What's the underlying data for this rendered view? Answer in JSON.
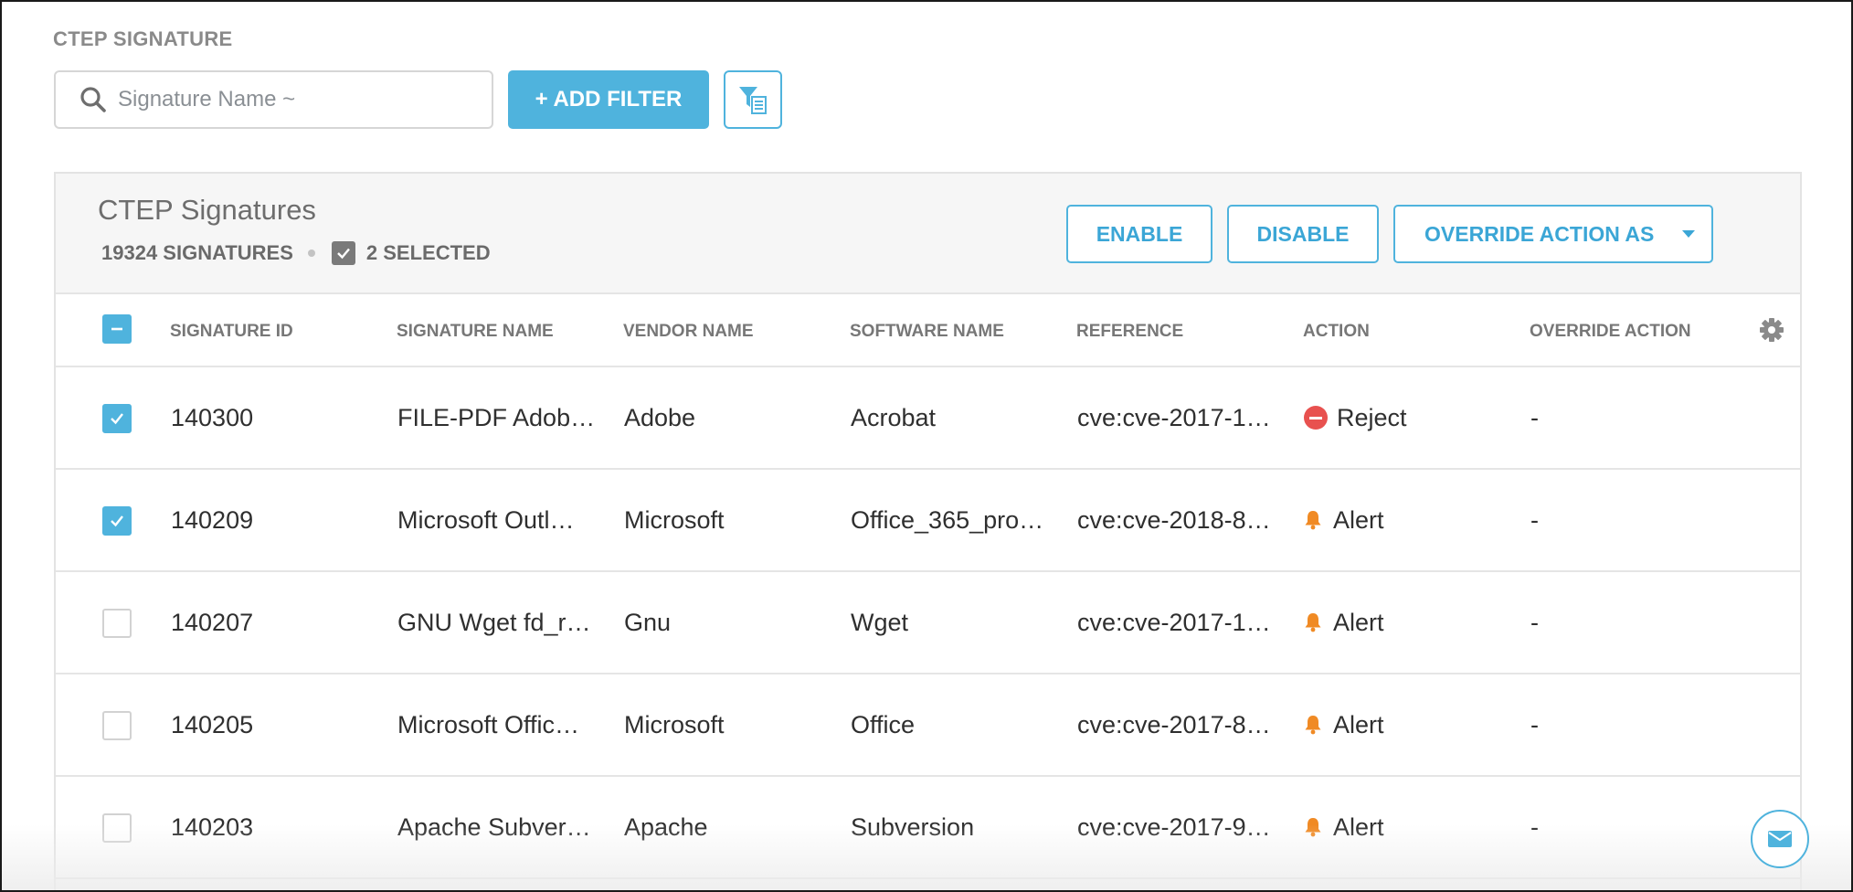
{
  "page": {
    "section_title": "CTEP SIGNATURE"
  },
  "search": {
    "placeholder": "Signature Name ~"
  },
  "toolbar": {
    "add_filter_label": "+ ADD FILTER"
  },
  "panel": {
    "title": "CTEP Signatures",
    "signature_count": "19324 SIGNATURES",
    "selected_label": "2 SELECTED",
    "buttons": {
      "enable": "ENABLE",
      "disable": "DISABLE",
      "override": "OVERRIDE ACTION AS"
    }
  },
  "table": {
    "columns": {
      "signature_id": "SIGNATURE ID",
      "signature_name": "SIGNATURE NAME",
      "vendor_name": "VENDOR NAME",
      "software_name": "SOFTWARE NAME",
      "reference": "REFERENCE",
      "action": "ACTION",
      "override_action": "OVERRIDE ACTION"
    },
    "rows": [
      {
        "checked": true,
        "id": "140300",
        "name": "FILE-PDF Adob…",
        "vendor": "Adobe",
        "software": "Acrobat",
        "reference": "cve:cve-2017-1…",
        "action": "Reject",
        "action_icon": "reject-icon",
        "override": "-"
      },
      {
        "checked": true,
        "id": "140209",
        "name": "Microsoft Outl…",
        "vendor": "Microsoft",
        "software": "Office_365_pro…",
        "reference": "cve:cve-2018-8…",
        "action": "Alert",
        "action_icon": "bell-icon",
        "override": "-"
      },
      {
        "checked": false,
        "id": "140207",
        "name": "GNU Wget fd_r…",
        "vendor": "Gnu",
        "software": "Wget",
        "reference": "cve:cve-2017-1…",
        "action": "Alert",
        "action_icon": "bell-icon",
        "override": "-"
      },
      {
        "checked": false,
        "id": "140205",
        "name": "Microsoft Offic…",
        "vendor": "Microsoft",
        "software": "Office",
        "reference": "cve:cve-2017-8…",
        "action": "Alert",
        "action_icon": "bell-icon",
        "override": "-"
      },
      {
        "checked": false,
        "id": "140203",
        "name": "Apache Subver…",
        "vendor": "Apache",
        "software": "Subversion",
        "reference": "cve:cve-2017-9…",
        "action": "Alert",
        "action_icon": "bell-icon",
        "override": "-"
      }
    ]
  },
  "colors": {
    "accent": "#4fb3dd",
    "reject": "#e8514f",
    "alert": "#f08a24"
  }
}
